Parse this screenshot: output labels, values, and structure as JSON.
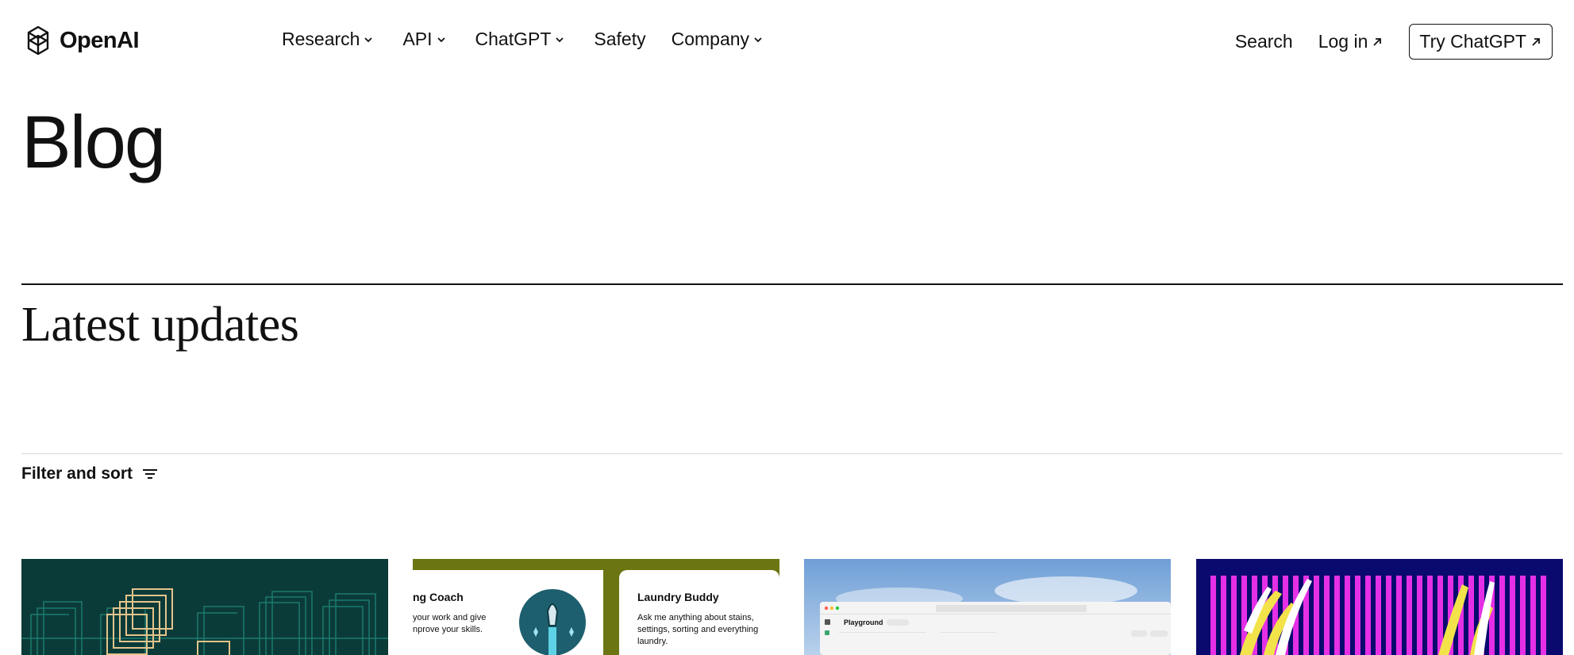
{
  "brand": {
    "name": "OpenAI",
    "logo_icon": "openai-logo-icon"
  },
  "nav": {
    "links": [
      {
        "label": "Research",
        "has_dropdown": true
      },
      {
        "label": "API",
        "has_dropdown": true
      },
      {
        "label": "ChatGPT",
        "has_dropdown": true
      },
      {
        "label": "Safety",
        "has_dropdown": false
      },
      {
        "label": "Company",
        "has_dropdown": true
      }
    ],
    "search_label": "Search",
    "login_label": "Log in",
    "cta_label": "Try ChatGPT"
  },
  "page": {
    "title": "Blog",
    "section_title": "Latest updates",
    "filter_label": "Filter and sort"
  },
  "cards": [
    {
      "image": "teal-squares-pattern",
      "bg": "#0b3b38",
      "accent": "#e3c48c",
      "line": "#1a7a6f"
    },
    {
      "image": "gpt-cards-collage",
      "bg": "#6b7612",
      "left_title": "ng Coach",
      "left_body_1": "your work and give",
      "left_body_2": "nprove your skills.",
      "right_title": "Laundry Buddy",
      "right_body_1": "Ask me anything about stains,",
      "right_body_2": "settings, sorting and everything",
      "right_body_3": "laundry.",
      "icon_bg": "#1d5f6e"
    },
    {
      "image": "playground-screenshot-sky",
      "window_title": "Playground",
      "sky": "#7aa6d6"
    },
    {
      "image": "magenta-stripes-art",
      "bg": "#0a0a6e",
      "stripe": "#e52fe6",
      "accent": "#f3e34a"
    }
  ],
  "colors": {
    "text": "#111111",
    "rule": "#111111",
    "rule_light": "#d9d9d9"
  }
}
